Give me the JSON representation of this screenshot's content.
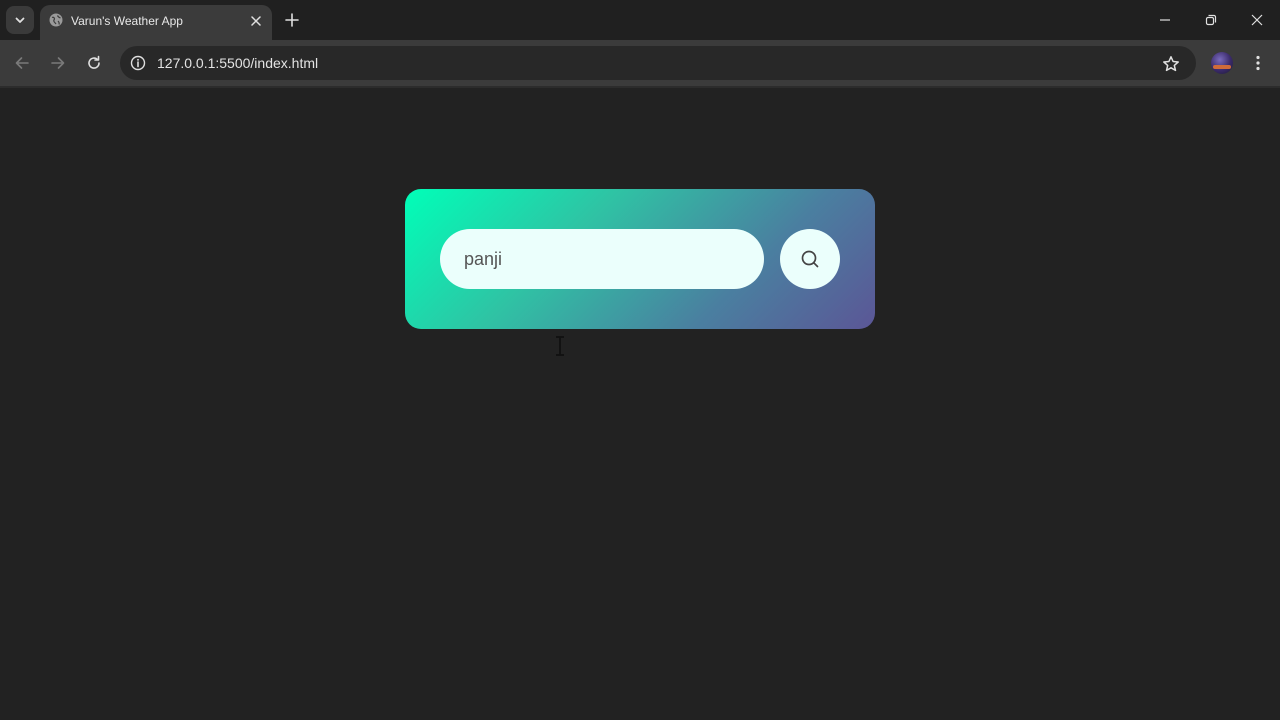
{
  "browser": {
    "tab": {
      "title": "Varun's Weather App",
      "favicon_icon": "globe-icon"
    },
    "address_bar": {
      "url": "127.0.0.1:5500/index.html"
    },
    "icons": {
      "tab_search": "chevron-down-icon",
      "tab_close": "close-icon",
      "new_tab": "plus-icon",
      "minimize": "minimize-icon",
      "restore": "restore-icon",
      "close_window": "close-icon",
      "back": "arrow-left-icon",
      "forward": "arrow-right-icon",
      "reload": "reload-icon",
      "site_info": "info-icon",
      "bookmark": "star-icon",
      "menu": "kebab-menu-icon"
    }
  },
  "weather_app": {
    "search": {
      "value": "panji",
      "placeholder": "",
      "button_icon": "search-icon"
    },
    "colors": {
      "gradient_start": "#00ffb8",
      "gradient_end": "#5b5696",
      "input_background": "#ebfffc",
      "page_background": "#222222"
    }
  }
}
